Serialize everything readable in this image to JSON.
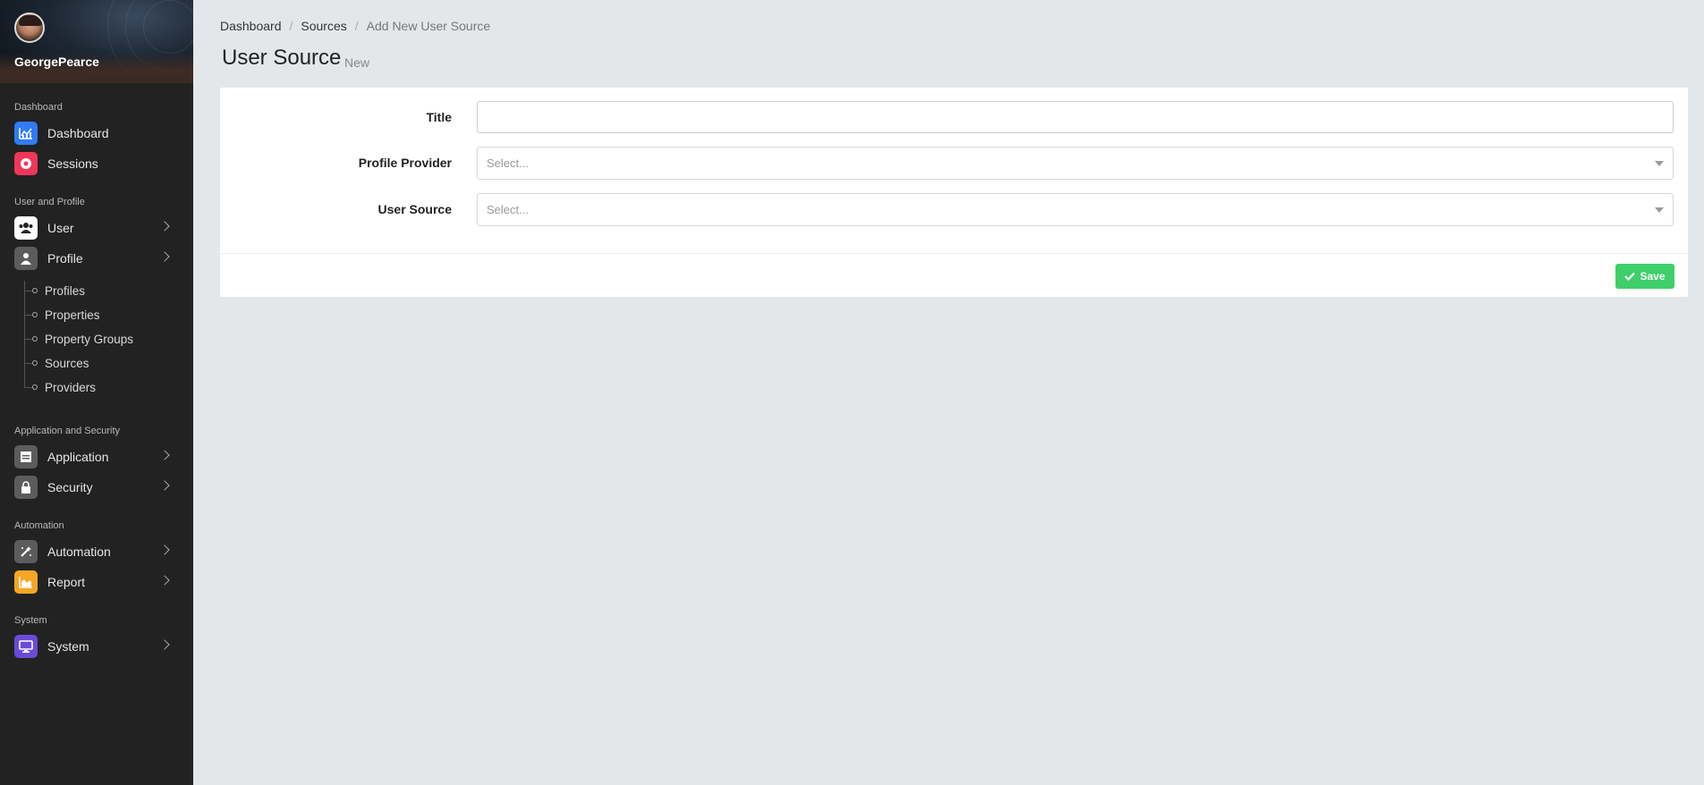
{
  "user": {
    "name": "GeorgePearce"
  },
  "sidebar": {
    "sections": [
      {
        "title": "Dashboard"
      },
      {
        "title": "User and Profile"
      },
      {
        "title": "Application and Security"
      },
      {
        "title": "Automation"
      },
      {
        "title": "System"
      }
    ],
    "items": {
      "dashboard": {
        "label": "Dashboard",
        "icon": "chart-icon",
        "color": "#2f7cf6"
      },
      "sessions": {
        "label": "Sessions",
        "icon": "record-icon",
        "color": "#f0365a"
      },
      "user": {
        "label": "User",
        "icon": "users-icon",
        "color": "#ffffff"
      },
      "profile": {
        "label": "Profile",
        "icon": "person-icon",
        "color": "#5c5c5c"
      },
      "application": {
        "label": "Application",
        "icon": "window-icon",
        "color": "#5c5c5c"
      },
      "security": {
        "label": "Security",
        "icon": "lock-icon",
        "color": "#5c5c5c"
      },
      "automation": {
        "label": "Automation",
        "icon": "wand-icon",
        "color": "#5c5c5c"
      },
      "report": {
        "label": "Report",
        "icon": "area-chart-icon",
        "color": "#f5a623"
      },
      "system": {
        "label": "System",
        "icon": "monitor-icon",
        "color": "#6a4bd8"
      }
    },
    "profile_children": [
      "Profiles",
      "Properties",
      "Property Groups",
      "Sources",
      "Providers"
    ]
  },
  "breadcrumb": [
    "Dashboard",
    "Sources",
    "Add New User Source"
  ],
  "page": {
    "title": "User Source",
    "subtitle": "New"
  },
  "form": {
    "title_label": "Title",
    "title_value": "",
    "profile_provider_label": "Profile Provider",
    "profile_provider_placeholder": "Select...",
    "user_source_label": "User Source",
    "user_source_placeholder": "Select...",
    "save_label": "Save"
  },
  "colors": {
    "accent_save": "#3fcf6a",
    "sidebar_bg": "#222222",
    "page_bg": "#e4e7e9"
  }
}
